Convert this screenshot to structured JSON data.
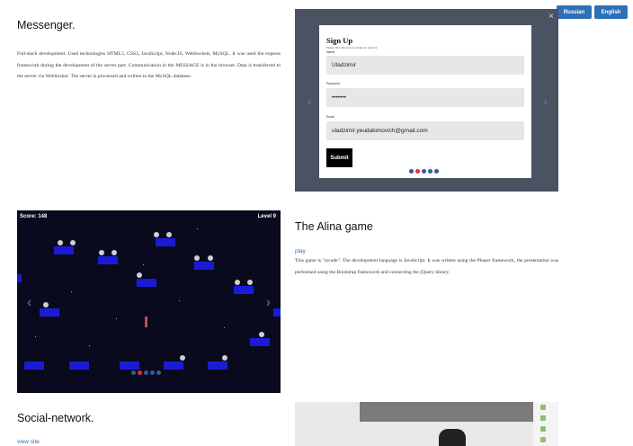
{
  "header": {
    "lang_russian": "Russian",
    "lang_english": "English"
  },
  "projects": [
    {
      "title": "Messenger.",
      "description": "Full-stack development. Used technologies HTML5, CSS3, JavaScript, Node.JS, WebSockets, MySQL. It was used the express framework during the development of the server part. Communication in the MESSAGE is in the browser. Data is transferred to the server via WebSocket. The server is processed and written to the MySQL database."
    },
    {
      "title": "The Alina game",
      "link": "play",
      "description": "This game is \"arcade\". The development language is JavaScript. It was written using the Phaser framework, the presentation was performed using the Bootstrap framework and connecting the jQuery library."
    },
    {
      "title": "Social-network.",
      "link": "view site"
    }
  ],
  "signup": {
    "close": "×",
    "title": "Sign Up",
    "subtitle": "Please fill in this form to create an account",
    "name_label": "Name",
    "name_value": "Uladzimir",
    "password_label": "Password",
    "password_value": "•••••••",
    "email_label": "Email",
    "email_value": "uladzimir.yeudakimovich@gmail.com",
    "submit_label": "Submit",
    "active_slide": 2,
    "slide_count": 5
  },
  "game": {
    "score": "Score: 148",
    "level": "Level 9",
    "active_slide": 2,
    "slide_count": 5
  },
  "colors": {
    "accent": "#2f6fb5",
    "slider_bg": "#4b5262",
    "platform": "#1b1bd6",
    "active_dot": "#e03030"
  }
}
